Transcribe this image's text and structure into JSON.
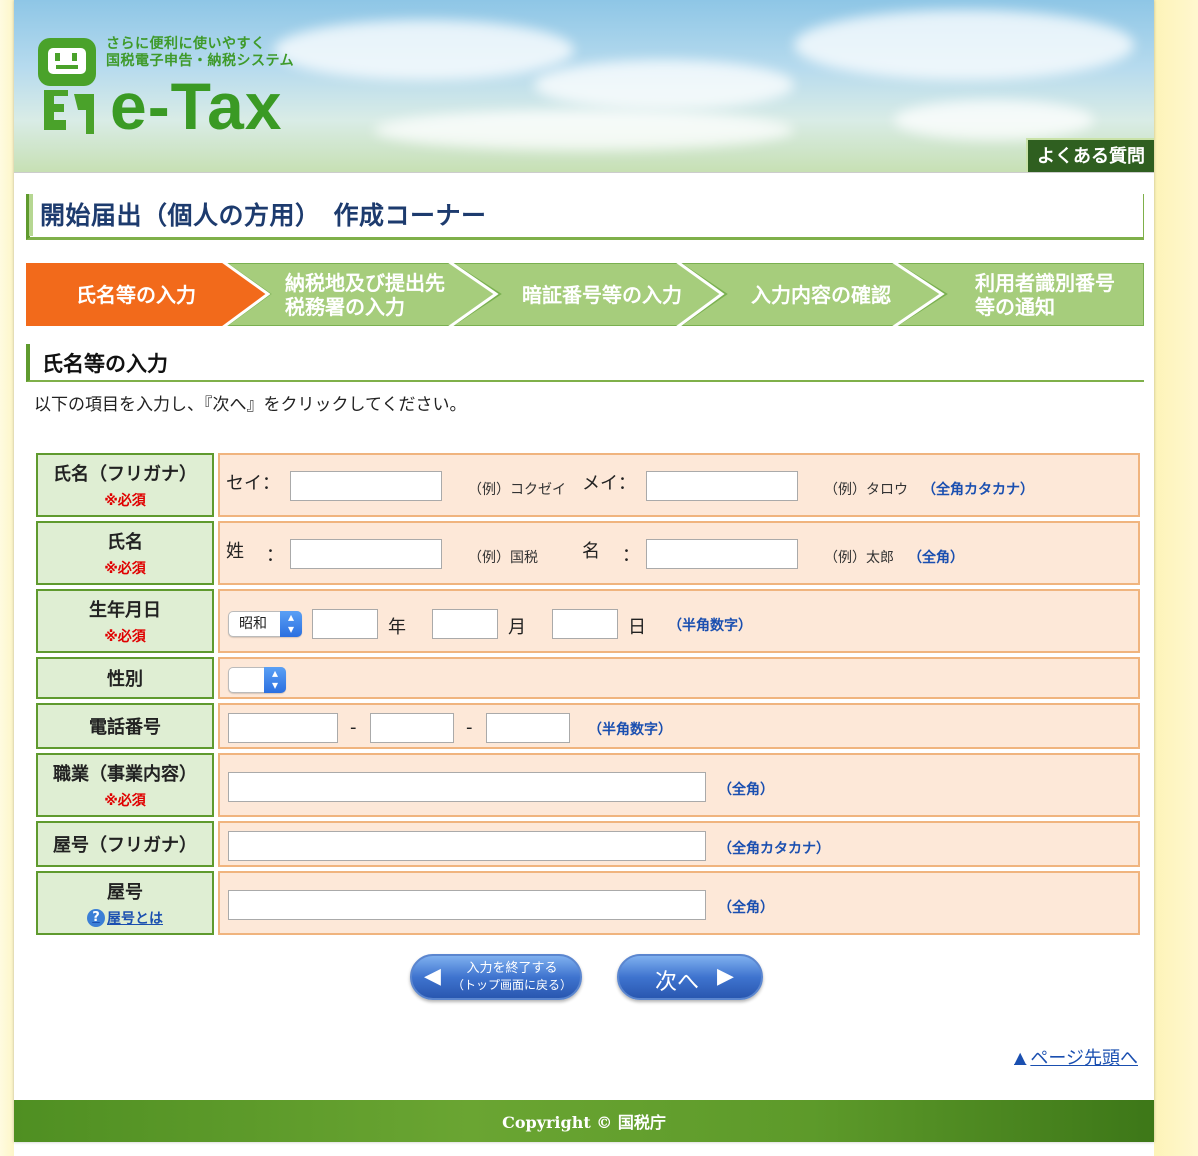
{
  "header": {
    "tagline_line1": "さらに便利に使いやすく",
    "tagline_line2": "国税電子申告・納税システム",
    "logo_text": "e-Tax",
    "faq_label": "よくある質問"
  },
  "page_title": "開始届出（個人の方用）　作成コーナー",
  "steps": [
    {
      "label": "氏名等の入力",
      "active": true
    },
    {
      "label": "納税地及び提出先\n税務署の入力",
      "active": false
    },
    {
      "label": "暗証番号等の入力",
      "active": false
    },
    {
      "label": "入力内容の確認",
      "active": false
    },
    {
      "label": "利用者識別番号\n等の通知",
      "active": false
    }
  ],
  "section_title": "氏名等の入力",
  "instruction": "以下の項目を入力し、『次へ』をクリックしてください。",
  "required_mark": "※必須",
  "form": {
    "kana": {
      "label": "氏名（フリガナ）",
      "sei_label": "セイ：",
      "sei_value": "",
      "sei_example": "（例）コクゼイ",
      "mei_label": "メイ：",
      "mei_value": "",
      "mei_example": "（例）タロウ",
      "note": "（全角カタカナ）"
    },
    "name": {
      "label": "氏名",
      "sei_label": "姓",
      "sei_colon": "：",
      "sei_value": "",
      "sei_example": "（例）国税",
      "mei_label": "名",
      "mei_colon": "：",
      "mei_value": "",
      "mei_example": "（例）太郎",
      "note": "（全角）"
    },
    "birth": {
      "label": "生年月日",
      "era_selected": "昭和",
      "year_unit": "年",
      "month_unit": "月",
      "day_unit": "日",
      "note": "（半角数字）"
    },
    "gender": {
      "label": "性別",
      "selected": ""
    },
    "phone": {
      "label": "電話番号",
      "sep1": "-",
      "sep2": "-",
      "note": "（半角数字）"
    },
    "job": {
      "label": "職業（事業内容）",
      "note": "（全角）"
    },
    "yago_kana": {
      "label": "屋号（フリガナ）",
      "note": "（全角カタカナ）"
    },
    "yago": {
      "label": "屋号",
      "help_link": "屋号とは",
      "note": "（全角）"
    }
  },
  "buttons": {
    "quit_line1": "入力を終了する",
    "quit_line2": "（トップ画面に戻る）",
    "next_label": "次へ"
  },
  "page_top_link": "ページ先頭へ",
  "footer": "Copyright © 国税庁",
  "colors": {
    "active_step": "#f26a1b",
    "inactive_step": "#a6cd7c",
    "accent_green": "#5f9a2e",
    "link_blue": "#1a4fb0",
    "required_red": "#e00000"
  },
  "icons": [
    "etax-mascot-icon",
    "help-icon",
    "arrow-left-icon",
    "arrow-right-icon",
    "page-top-arrow-icon",
    "chevron-updown-icon"
  ]
}
